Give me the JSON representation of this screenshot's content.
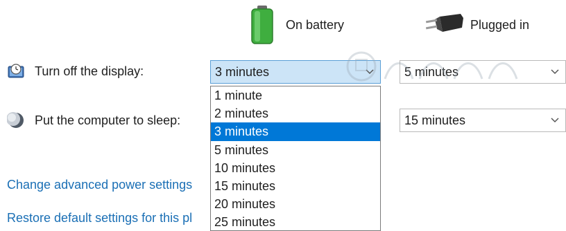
{
  "columns": {
    "battery_label": "On battery",
    "plugged_label": "Plugged in"
  },
  "rows": [
    {
      "label": "Turn off the display:",
      "icon": "monitor-clock-icon",
      "battery_value": "3 minutes",
      "plugged_value": "5 minutes"
    },
    {
      "label": "Put the computer to sleep:",
      "icon": "moon-icon",
      "plugged_value": "15 minutes"
    }
  ],
  "dropdown": {
    "selected": "3 minutes",
    "options": [
      "1 minute",
      "2 minutes",
      "3 minutes",
      "5 minutes",
      "10 minutes",
      "15 minutes",
      "20 minutes",
      "25 minutes"
    ]
  },
  "links": {
    "advanced": "Change advanced power settings",
    "restore": "Restore default settings for this pl"
  },
  "colors": {
    "link": "#1a6fb5",
    "selection": "#0078d7",
    "open_combo": "#cce4f7"
  }
}
